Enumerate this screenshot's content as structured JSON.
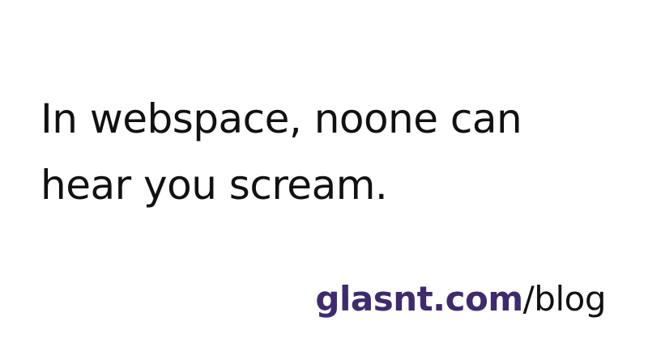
{
  "headline": {
    "line1": "In webspace, noone can",
    "line2": "hear you scream."
  },
  "footer": {
    "domain": "glasnt.com",
    "path": "/blog"
  },
  "colors": {
    "background": "#ffffff",
    "text": "#111111",
    "brand": "#3f2a6e"
  }
}
